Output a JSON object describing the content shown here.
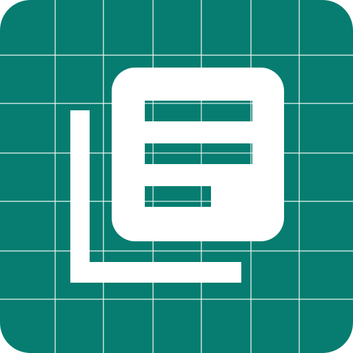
{
  "app_icon": {
    "name": "stacked-document-list-icon",
    "background_color": "#067D70",
    "grid_color": "#E6F4F1",
    "foreground_color": "#FFFFFF",
    "tile_corner": "rounded-square"
  }
}
